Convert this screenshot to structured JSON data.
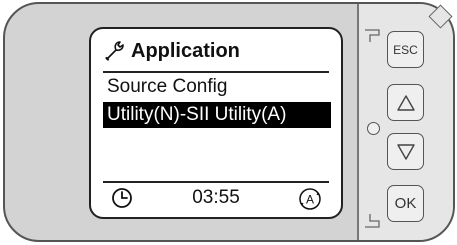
{
  "screen": {
    "title": "Application",
    "line1": "Source Config",
    "line2_selected": "Utility(N)-SII Utility(A)",
    "time": "03:55"
  },
  "keypad": {
    "esc_label": "ESC",
    "ok_label": "OK"
  },
  "icons": {
    "title_icon": "wrench-icon",
    "clock_icon": "clock-icon",
    "auto_icon": "auto-mode-icon",
    "up_icon": "triangle-up-icon",
    "down_icon": "triangle-down-icon"
  },
  "colors": {
    "housing": "#d3d3d3",
    "keypad": "#e6e6e6",
    "screen": "#ffffff",
    "selection": "#000000"
  }
}
